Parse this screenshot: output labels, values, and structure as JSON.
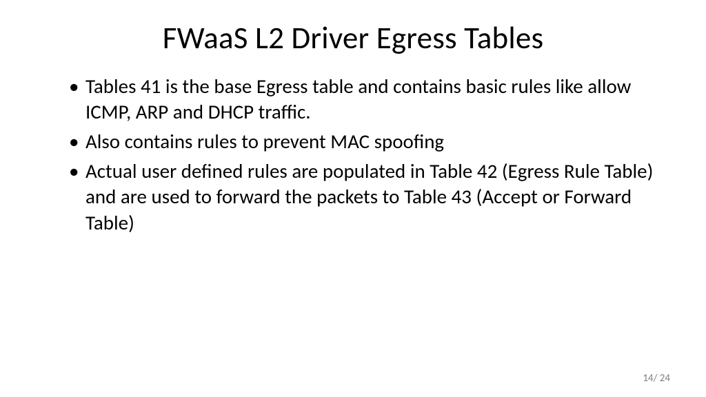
{
  "slide": {
    "title": "FWaaS L2 Driver Egress Tables",
    "bullets": [
      "Tables 41 is the base Egress table and contains basic rules like allow ICMP, ARP and DHCP traffic.",
      "Also contains rules to prevent MAC spoofing",
      "Actual user defined rules are populated in Table 42 (Egress Rule Table) and are used to forward the packets to Table 43 (Accept or Forward Table)"
    ],
    "page_number": "14/ 24"
  }
}
